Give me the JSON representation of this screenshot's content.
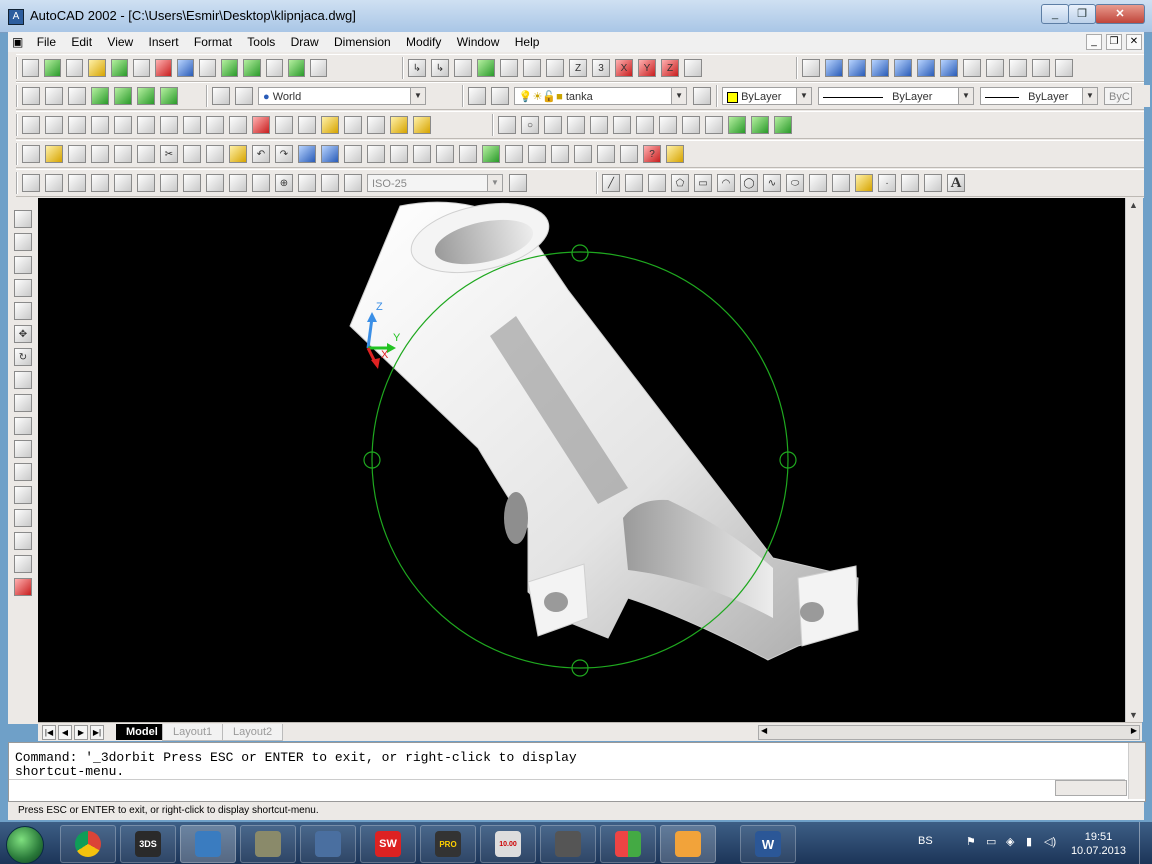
{
  "window": {
    "title": "AutoCAD 2002 - [C:\\Users\\Esmir\\Desktop\\klipnjaca.dwg]",
    "controls": [
      "_",
      "❐",
      "✕"
    ]
  },
  "menu": {
    "items": [
      "File",
      "Edit",
      "View",
      "Insert",
      "Format",
      "Tools",
      "Draw",
      "Dimension",
      "Modify",
      "Window",
      "Help"
    ],
    "doc_controls": [
      "_",
      "❐",
      "✕"
    ]
  },
  "toolbars": {
    "ucs_combo": "World",
    "layer_combo": "tanka",
    "color_combo": "ByLayer",
    "linetype_combo": "ByLayer",
    "lineweight_combo": "ByLayer",
    "plotstyle_combo": "ByC",
    "dimstyle_combo": "ISO-25",
    "text_icon_label": "A"
  },
  "viewport": {
    "ucs_labels": {
      "z": "Z",
      "y": "Y",
      "x": "X"
    },
    "orbit_color": "#1fa81f",
    "background": "#000000"
  },
  "tabs": {
    "model": "Model",
    "layout1": "Layout1",
    "layout2": "Layout2"
  },
  "command": {
    "line1": "Command: '_3dorbit Press ESC or ENTER to exit, or right-click to display",
    "line2": "shortcut-menu."
  },
  "status": {
    "text": "Press ESC or ENTER to exit, or right-click to display shortcut-menu."
  },
  "taskbar": {
    "apps": [
      {
        "name": "chrome",
        "label": ""
      },
      {
        "name": "3dsmax",
        "label": "3DS"
      },
      {
        "name": "autocad",
        "label": ""
      },
      {
        "name": "app4",
        "label": ""
      },
      {
        "name": "app5",
        "label": ""
      },
      {
        "name": "solidworks",
        "label": "SW"
      },
      {
        "name": "pro-engineer",
        "label": "PRO"
      },
      {
        "name": "dimension-tool",
        "label": "10.00"
      },
      {
        "name": "app9",
        "label": ""
      },
      {
        "name": "app10",
        "label": ""
      },
      {
        "name": "app11",
        "label": ""
      },
      {
        "name": "word",
        "label": "W"
      }
    ],
    "language": "BS",
    "time": "19:51",
    "date": "10.07.2013"
  }
}
